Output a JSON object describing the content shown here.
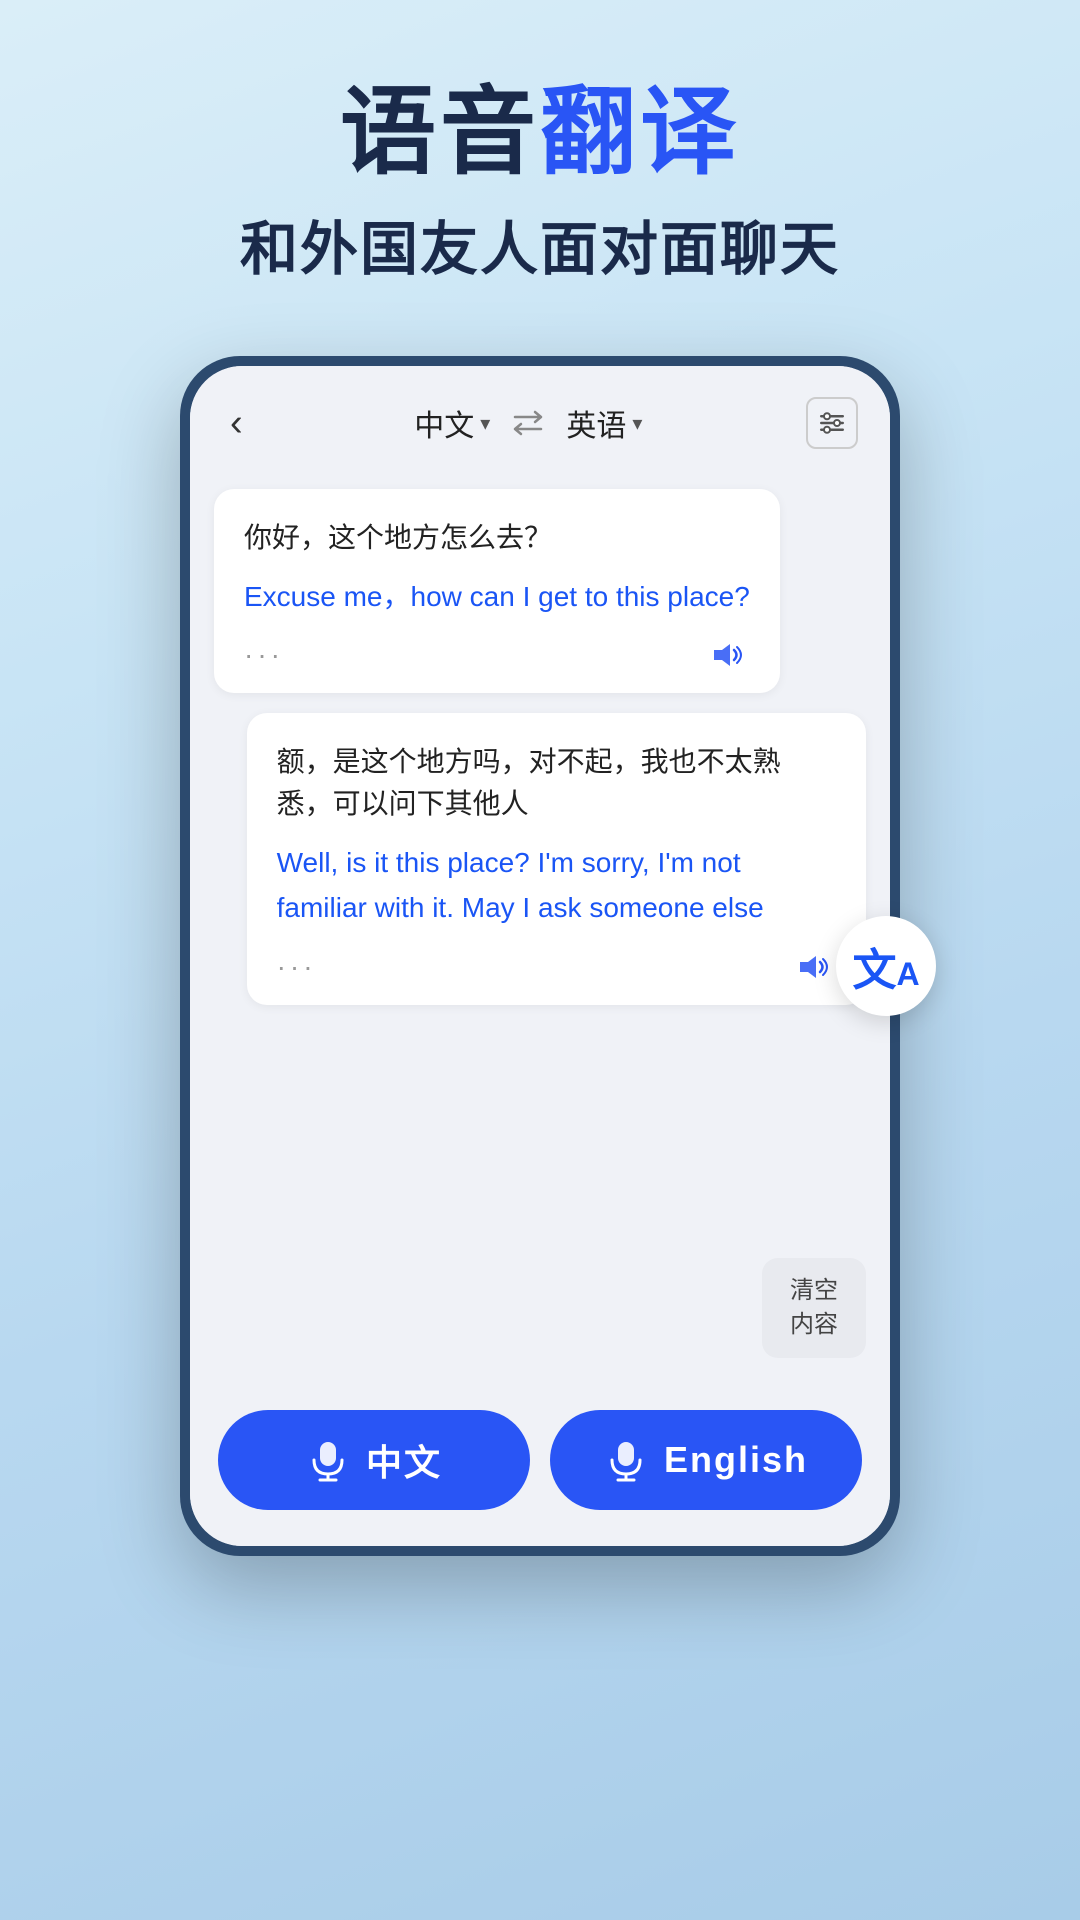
{
  "headline": {
    "part1": "语音",
    "part2": "翻译",
    "subtitle": "和外国友人面对面聊天"
  },
  "nav": {
    "back_label": "‹",
    "lang_from": "中文",
    "lang_to": "英语",
    "from_arrow": "▾",
    "to_arrow": "▾"
  },
  "messages": [
    {
      "original": "你好，这个地方怎么去？",
      "translated": "Excuse me，how can I get to this place?",
      "side": "left"
    },
    {
      "original": "额，是这个地方吗，对不起，我也不太熟悉，可以问下其他人",
      "translated": "Well, is it this place? I'm sorry, I'm not familiar with it. May I ask someone else",
      "side": "right"
    }
  ],
  "clear_btn": {
    "line1": "清空",
    "line2": "内容"
  },
  "mic_buttons": [
    {
      "label": "中文"
    },
    {
      "label": "English"
    }
  ],
  "floating": {
    "text": "文A"
  },
  "icons": {
    "speaker": "🔊",
    "mic": "🎤",
    "settings": "⚙"
  }
}
